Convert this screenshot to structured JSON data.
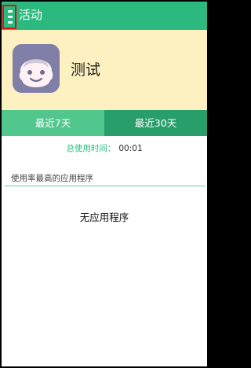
{
  "header": {
    "title": "活动",
    "menu_icon": "hamburger-menu-icon",
    "accent_color": "#2bb980",
    "highlight_color": "#e01010"
  },
  "profile": {
    "name": "测试",
    "avatar_icon": "baby-face-avatar-icon",
    "background": "#fdf0c1"
  },
  "tabs": [
    {
      "label": "最近7天",
      "selected": true
    },
    {
      "label": "最近30天",
      "selected": false
    }
  ],
  "usage": {
    "label": "总使用时间：",
    "value": "00:01"
  },
  "section": {
    "title": "使用率最高的应用程序",
    "empty_text": "无应用程序"
  }
}
